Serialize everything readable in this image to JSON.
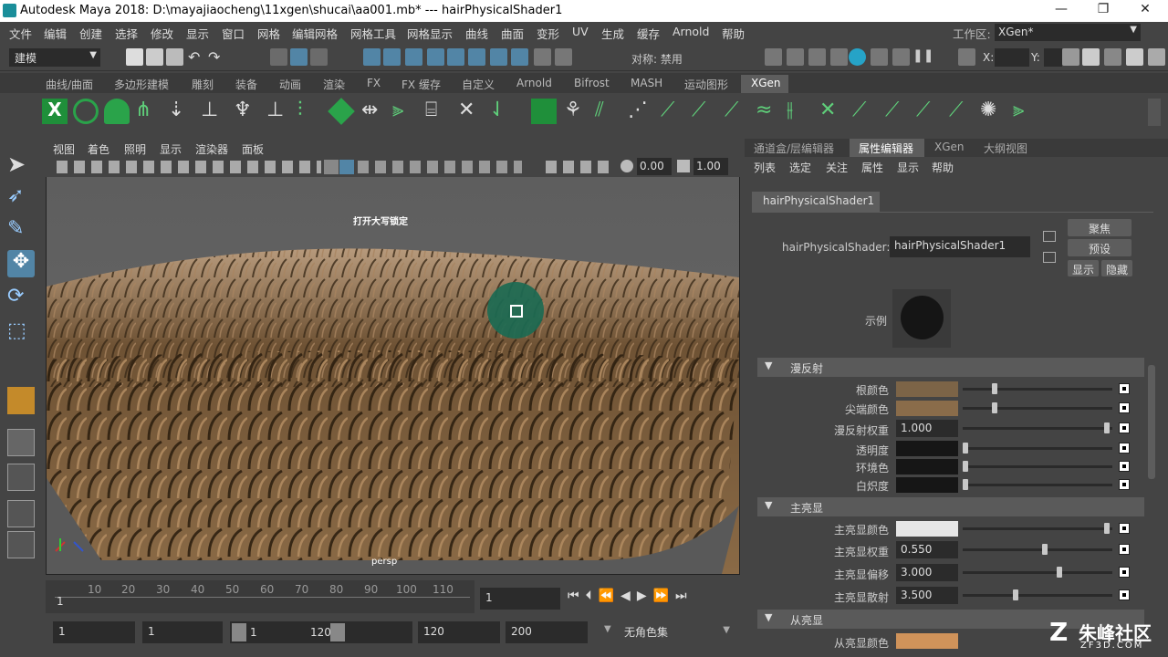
{
  "window": {
    "title": "Autodesk Maya 2018: D:\\mayajiaocheng\\11xgen\\shucai\\aa001.mb*   ---   hairPhysicalShader1",
    "min": "—",
    "max": "❐",
    "close": "✕"
  },
  "menubar": {
    "items": [
      "文件",
      "编辑",
      "创建",
      "选择",
      "修改",
      "显示",
      "窗口",
      "网格",
      "编辑网格",
      "网格工具",
      "网格显示",
      "曲线",
      "曲面",
      "变形",
      "UV",
      "生成",
      "缓存",
      "Arnold",
      "帮助"
    ],
    "workspace_label": "工作区:",
    "workspace_value": "XGen*"
  },
  "statusline": {
    "mode": "建模",
    "symmetry": "对称: 禁用",
    "x_label": "X:",
    "y_label": "Y:"
  },
  "shelf": {
    "tabs": [
      "曲线/曲面",
      "多边形建模",
      "雕刻",
      "装备",
      "动画",
      "渲染",
      "FX",
      "FX 缓存",
      "自定义",
      "Arnold",
      "Bifrost",
      "MASH",
      "运动图形",
      "XGen"
    ],
    "active_tab": "XGen"
  },
  "viewport": {
    "menu": [
      "视图",
      "着色",
      "照明",
      "显示",
      "渲染器",
      "面板"
    ],
    "field1": "0.00",
    "field2": "1.00",
    "hud_caps": "打开大写锁定",
    "camera": "persp"
  },
  "timeline": {
    "ticks": [
      "1",
      "10",
      "20",
      "30",
      "40",
      "50",
      "60",
      "70",
      "80",
      "90",
      "100",
      "110"
    ],
    "current_frame": "1"
  },
  "range": {
    "start": "1",
    "anim_start": "1",
    "slider_start": "1",
    "slider_end": "120",
    "end": "120",
    "anim_end": "200",
    "charset": "无角色集"
  },
  "attr_editor": {
    "tabs": [
      "通道盒/层编辑器",
      "属性编辑器",
      "XGen",
      "大纲视图"
    ],
    "active_tab": "属性编辑器",
    "menu": [
      "列表",
      "选定",
      "关注",
      "属性",
      "显示",
      "帮助"
    ],
    "node_tab": "hairPhysicalShader1",
    "node_label": "hairPhysicalShader:",
    "node_value": "hairPhysicalShader1",
    "btn_focus": "聚焦",
    "btn_preset": "预设",
    "btn_show": "显示",
    "btn_hide": "隐藏",
    "sample_label": "示例",
    "sections": [
      {
        "title": "漫反射",
        "rows": [
          {
            "label": "根颜色",
            "kind": "color",
            "color": "#7c6447",
            "slider": 0.2
          },
          {
            "label": "尖端颜色",
            "kind": "color",
            "color": "#8a6c4a",
            "slider": 0.2
          },
          {
            "label": "漫反射权重",
            "kind": "num",
            "value": "1.000",
            "slider": 0.98
          },
          {
            "label": "透明度",
            "kind": "color",
            "color": "#161616",
            "slider": 0.0
          },
          {
            "label": "环境色",
            "kind": "color",
            "color": "#161616",
            "slider": 0.0
          },
          {
            "label": "白炽度",
            "kind": "color",
            "color": "#161616",
            "slider": 0.0
          }
        ]
      },
      {
        "title": "主亮显",
        "rows": [
          {
            "label": "主亮显颜色",
            "kind": "color",
            "color": "#e6e6e6",
            "slider": 0.98
          },
          {
            "label": "主亮显权重",
            "kind": "num",
            "value": "0.550",
            "slider": 0.55
          },
          {
            "label": "主亮显偏移",
            "kind": "num",
            "value": "3.000",
            "slider": 0.65
          },
          {
            "label": "主亮显散射",
            "kind": "num",
            "value": "3.500",
            "slider": 0.35
          }
        ]
      },
      {
        "title": "从亮显",
        "rows": [
          {
            "label": "从亮显颜色",
            "kind": "color",
            "color": "#d0935a",
            "slider": 0.6
          }
        ]
      }
    ]
  },
  "watermark": {
    "text": "朱峰社区",
    "sub": "ZF3D.COM"
  },
  "colors": {
    "panel": "#444444",
    "field": "#2b2b2b",
    "accent": "#5285a6",
    "active_tab": "#5d5d5d"
  }
}
